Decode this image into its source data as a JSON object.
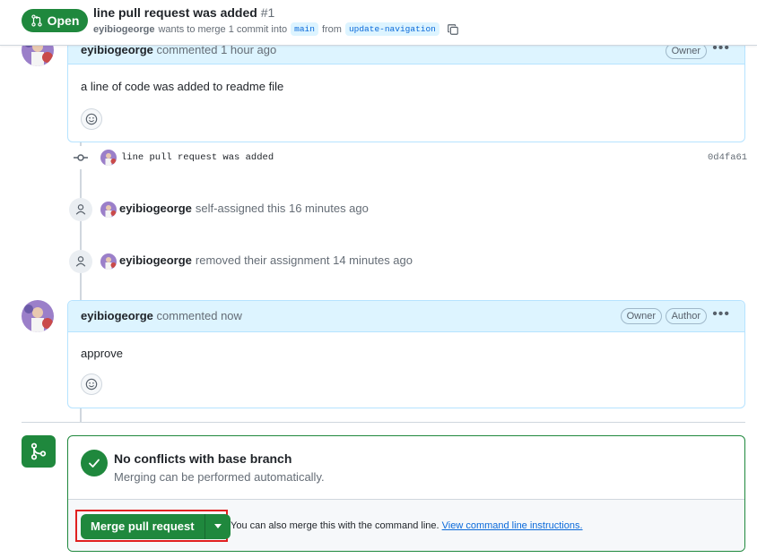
{
  "header": {
    "state_label": "Open",
    "title": "line pull request was added",
    "number": "#1",
    "author": "eyibiogeorge",
    "merge_text": "wants to merge 1 commit into",
    "base_branch": "main",
    "from_text": "from",
    "head_branch": "update-navigation"
  },
  "comment1": {
    "author": "eyibiogeorge",
    "meta": "commented 1 hour ago",
    "badge_owner": "Owner",
    "body": "a line of code was added to readme file"
  },
  "commit": {
    "message": "line pull request was added",
    "sha": "0d4fa61"
  },
  "event1": {
    "user": "eyibiogeorge",
    "text": "self-assigned this 16 minutes ago"
  },
  "event2": {
    "user": "eyibiogeorge",
    "text": "removed their assignment 14 minutes ago"
  },
  "comment2": {
    "author": "eyibiogeorge",
    "meta": "commented now",
    "badge_owner": "Owner",
    "badge_author": "Author",
    "body": "approve"
  },
  "merge": {
    "title": "No conflicts with base branch",
    "subtitle": "Merging can be performed automatically.",
    "button_label": "Merge pull request",
    "note": "You can also merge this with the command line.",
    "link": "View command line instructions."
  },
  "colors": {
    "green": "#1f883d",
    "blue_header": "#ddf4ff",
    "link": "#0969da",
    "highlight": "#e02020"
  },
  "icons": [
    "git-pull-request-icon",
    "copy-icon",
    "kebab-icon",
    "smiley-icon",
    "git-commit-icon",
    "person-icon",
    "git-merge-icon",
    "check-icon",
    "triangle-down-icon"
  ]
}
